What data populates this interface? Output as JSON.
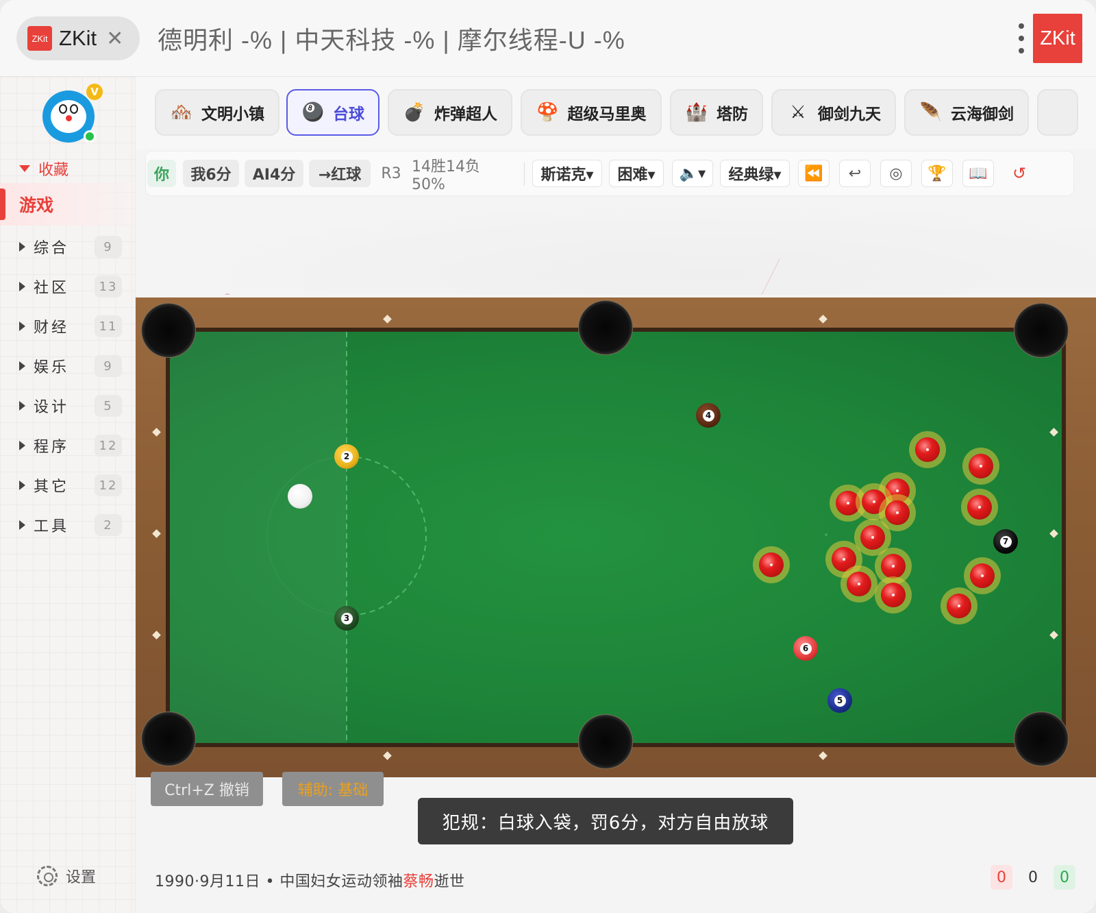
{
  "titlebar": {
    "app_logo_text": "ZKit",
    "app_name": "ZKit",
    "ticker": "德明利 -% | 中天科技 -% | 摩尔线程-U -%",
    "brand_badge": "ZKit"
  },
  "sidebar": {
    "favorites_label": "收藏",
    "active_item": "游戏",
    "categories": [
      {
        "name": "综合",
        "count": "9"
      },
      {
        "name": "社区",
        "count": "13"
      },
      {
        "name": "财经",
        "count": "11"
      },
      {
        "name": "娱乐",
        "count": "9"
      },
      {
        "name": "设计",
        "count": "5"
      },
      {
        "name": "程序",
        "count": "12"
      },
      {
        "name": "其它",
        "count": "12"
      },
      {
        "name": "工具",
        "count": "2"
      }
    ],
    "settings_label": "设置"
  },
  "game_tabs": [
    {
      "label": "文明小镇",
      "icon": "house-icon",
      "glyph": "🏘️"
    },
    {
      "label": "台球",
      "icon": "8-ball-icon",
      "glyph": "🎱",
      "active": true
    },
    {
      "label": "炸弹超人",
      "icon": "bomb-icon",
      "glyph": "💣"
    },
    {
      "label": "超级马里奥",
      "icon": "mushroom-icon",
      "glyph": "🍄"
    },
    {
      "label": "塔防",
      "icon": "castle-icon",
      "glyph": "🏰"
    },
    {
      "label": "御剑九天",
      "icon": "crossed-swords-icon",
      "glyph": "⚔"
    },
    {
      "label": "云海御剑",
      "icon": "feather-icon",
      "glyph": "🪶"
    }
  ],
  "toolbar": {
    "turn": "你",
    "my_score": "我6分",
    "ai_score": "AI4分",
    "target": "→红球",
    "round": "R3",
    "record": "14胜14负 50%",
    "mode_select": "斯诺克▾",
    "difficulty_select": "困难▾",
    "sound_select": "🔈▾",
    "theme_select": "经典绿▾",
    "icons": [
      "rewind-icon",
      "return-icon",
      "target-icon",
      "trophy-icon",
      "book-icon",
      "restart-icon"
    ],
    "icon_glyphs": [
      "⏪",
      "↩",
      "◎",
      "🏆",
      "📖",
      "↺"
    ]
  },
  "table": {
    "felt_color": "#1d8338",
    "rail_color": "#8a5c34",
    "numbered_balls": [
      {
        "num": "2",
        "color": "#e8b21a"
      },
      {
        "num": "3",
        "color": "#1f4a22"
      },
      {
        "num": "4",
        "color": "#5a2a12"
      },
      {
        "num": "5",
        "color": "#1a2d8a"
      },
      {
        "num": "6",
        "color": "#e23a3a"
      },
      {
        "num": "7",
        "color": "#0a0a0a"
      }
    ],
    "red_count": 15
  },
  "footer": {
    "undo_label": "Ctrl+Z 撤销",
    "assist_label": "辅助: 基础",
    "toast": "犯规：白球入袋，罚6分，对方自由放球",
    "news_prefix": "1990·9月11日 • 中国妇女运动领袖",
    "news_highlight": "蔡畅",
    "news_suffix": "逝世",
    "scores": [
      "0",
      "0",
      "0"
    ]
  }
}
